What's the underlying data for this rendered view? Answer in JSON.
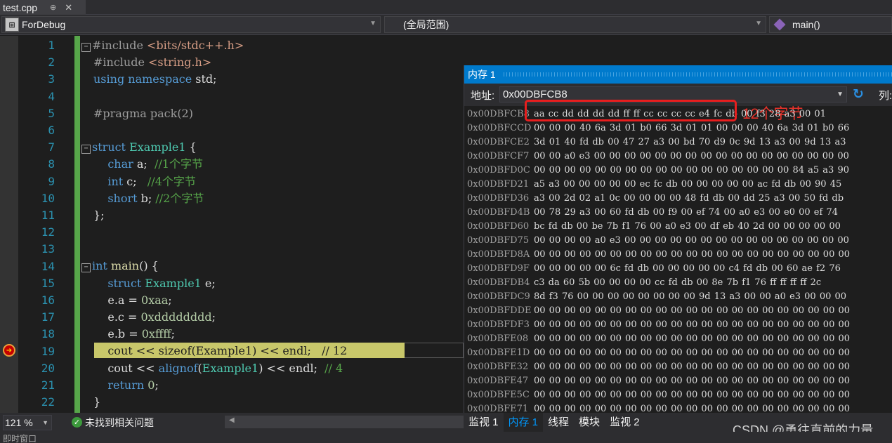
{
  "tab": {
    "title": "test.cpp",
    "pin": "⊕",
    "close": "✕"
  },
  "navbar": {
    "project": "ForDebug",
    "scope": "(全局范围)",
    "function": "main()"
  },
  "editor": {
    "line_numbers": [
      "1",
      "2",
      "3",
      "4",
      "5",
      "6",
      "7",
      "8",
      "9",
      "10",
      "11",
      "12",
      "13",
      "14",
      "15",
      "16",
      "17",
      "18",
      "19",
      "20",
      "21",
      "22"
    ],
    "lines": [
      "#include <bits/stdc++.h>",
      "#include <string.h>",
      "using namespace std;",
      "",
      "#pragma pack(2)",
      "",
      "struct Example1 {",
      "    char a;  //1个字节",
      "    int c;   //4个字节",
      "    short b; //2个字节",
      "};",
      "",
      "",
      "int main() {",
      "    struct Example1 e;",
      "    e.a = 0xaa;",
      "    e.c = 0xdddddddd;",
      "    e.b = 0xffff;",
      "    cout << sizeof(Example1) << endl;   // 12",
      "    cout << alignof(Example1) << endl;  // 4",
      "    return 0;",
      "}"
    ]
  },
  "memory": {
    "title": "内存 1",
    "address_label": "地址:",
    "address_value": "0x00DBFCB8",
    "column_label": "列:",
    "annotation": "12个字节",
    "rows": [
      {
        "addr": "0x00DBFCB8",
        "bytes": "aa cc dd dd dd dd ff ff cc cc cc cc e4 fc db 00 f3 28 a3 00 01"
      },
      {
        "addr": "0x00DBFCCD",
        "bytes": "00 00 00 40 6a 3d 01 b0 66 3d 01 01 00 00 00 40 6a 3d 01 b0 66"
      },
      {
        "addr": "0x00DBFCE2",
        "bytes": "3d 01 40 fd db 00 47 27 a3 00 bd 70 d9 0c 9d 13 a3 00 9d 13 a3"
      },
      {
        "addr": "0x00DBFCF7",
        "bytes": "00 00 a0 e3 00 00 00 00 00 00 00 00 00 00 00 00 00 00 00 00 00"
      },
      {
        "addr": "0x00DBFD0C",
        "bytes": "00 00 00 00 00 00 00 00 00 00 00 00 00 00 00 00 00 84 a5 a3 90"
      },
      {
        "addr": "0x00DBFD21",
        "bytes": "a5 a3 00 00 00 00 00 ec fc db 00 00 00 00 00 ac fd db 00 90 45"
      },
      {
        "addr": "0x00DBFD36",
        "bytes": "a3 00 2d 02 a1 0c 00 00 00 00 48 fd db 00 dd 25 a3 00 50 fd db"
      },
      {
        "addr": "0x00DBFD4B",
        "bytes": "00 78 29 a3 00 60 fd db 00 f9 00 ef 74 00 a0 e3 00 e0 00 ef 74"
      },
      {
        "addr": "0x00DBFD60",
        "bytes": "bc fd db 00 be 7b f1 76 00 a0 e3 00 df eb 40 2d 00 00 00 00 00"
      },
      {
        "addr": "0x00DBFD75",
        "bytes": "00 00 00 00 a0 e3 00 00 00 00 00 00 00 00 00 00 00 00 00 00 00"
      },
      {
        "addr": "0x00DBFD8A",
        "bytes": "00 00 00 00 00 00 00 00 00 00 00 00 00 00 00 00 00 00 00 00 00"
      },
      {
        "addr": "0x00DBFD9F",
        "bytes": "00 00 00 00 00 6c fd db 00 00 00 00 00 c4 fd db 00 60 ae f2 76"
      },
      {
        "addr": "0x00DBFDB4",
        "bytes": "c3 da 60 5b 00 00 00 00 cc fd db 00 8e 7b f1 76 ff ff ff ff 2c"
      },
      {
        "addr": "0x00DBFDC9",
        "bytes": "8d f3 76 00 00 00 00 00 00 00 00 9d 13 a3 00 00 a0 e3 00 00 00"
      },
      {
        "addr": "0x00DBFDDE",
        "bytes": "00 00 00 00 00 00 00 00 00 00 00 00 00 00 00 00 00 00 00 00 00"
      },
      {
        "addr": "0x00DBFDF3",
        "bytes": "00 00 00 00 00 00 00 00 00 00 00 00 00 00 00 00 00 00 00 00 00"
      },
      {
        "addr": "0x00DBFE08",
        "bytes": "00 00 00 00 00 00 00 00 00 00 00 00 00 00 00 00 00 00 00 00 00"
      },
      {
        "addr": "0x00DBFE1D",
        "bytes": "00 00 00 00 00 00 00 00 00 00 00 00 00 00 00 00 00 00 00 00 00"
      },
      {
        "addr": "0x00DBFE32",
        "bytes": "00 00 00 00 00 00 00 00 00 00 00 00 00 00 00 00 00 00 00 00 00"
      },
      {
        "addr": "0x00DBFE47",
        "bytes": "00 00 00 00 00 00 00 00 00 00 00 00 00 00 00 00 00 00 00 00 00"
      },
      {
        "addr": "0x00DBFE5C",
        "bytes": "00 00 00 00 00 00 00 00 00 00 00 00 00 00 00 00 00 00 00 00 00"
      },
      {
        "addr": "0x00DBFE71",
        "bytes": "00 00 00 00 00 00 00 00 00 00 00 00 00 00 00 00 00 00 00 00 00"
      }
    ],
    "tabs": [
      "监视 1",
      "内存 1",
      "线程",
      "模块",
      "监视 2"
    ],
    "active_tab": 1
  },
  "status": {
    "zoom": "121 %",
    "issues": "未找到相关问题",
    "bottom": "即时窗口"
  },
  "watermark": "CSDN @勇往直前的力量",
  "colors": {
    "accent": "#007acc",
    "annotation": "#e81e1e",
    "current_line": "#c8c76a",
    "change_bar": "#57a64a"
  }
}
